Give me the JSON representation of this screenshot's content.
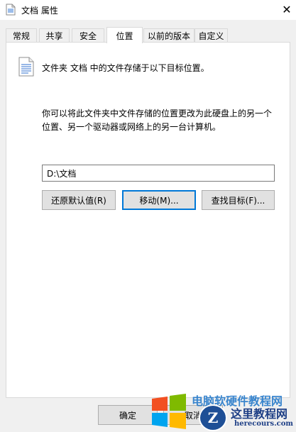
{
  "window": {
    "title": "文档 属性",
    "close_glyph": "✕"
  },
  "tabs": [
    {
      "label": "常规"
    },
    {
      "label": "共享"
    },
    {
      "label": "安全"
    },
    {
      "label": "位置"
    },
    {
      "label": "以前的版本"
    },
    {
      "label": "自定义"
    }
  ],
  "active_tab": "位置",
  "location": {
    "intro": "文件夹 文档 中的文件存储于以下目标位置。",
    "description": "你可以将此文件夹中文件存储的位置更改为此硬盘上的另一个位置、另一个驱动器或网络上的另一台计算机。",
    "path_value": "D:\\文档",
    "restore_default_label": "还原默认值(R)",
    "move_label": "移动(M)...",
    "find_target_label": "查找目标(F)..."
  },
  "footer": {
    "ok_label": "确定",
    "cancel_label": "取消"
  },
  "watermark": {
    "site_name": "这里教程网",
    "url": "herecours.com",
    "overlay_text": "电脑软硬件教程网",
    "logo_letter": "Z"
  },
  "colors": {
    "focus_border": "#0078d7",
    "window_bg": "#f0f0f0",
    "panel_bg": "#ffffff"
  }
}
